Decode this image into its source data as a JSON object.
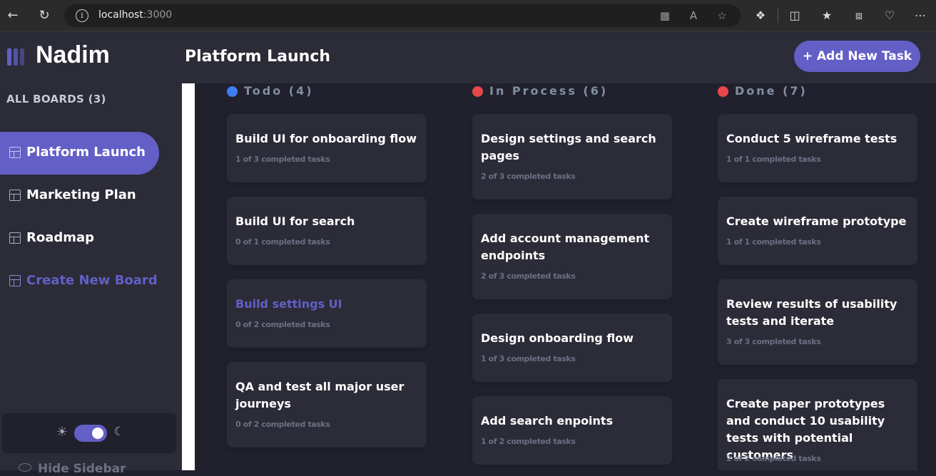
{
  "browser": {
    "url_host": "localhost",
    "url_port": ":3000"
  },
  "sidebar": {
    "brand": "Nadim",
    "all_boards_label": "ALL BOARDS (3)",
    "boards": [
      {
        "label": "Platform Launch"
      },
      {
        "label": "Marketing Plan"
      },
      {
        "label": "Roadmap"
      }
    ],
    "create_board_label": "Create New Board",
    "hide_sidebar_label": "Hide Sidebar",
    "dark_mode": true
  },
  "header": {
    "title": "Platform Launch",
    "add_task_label": "+ Add New Task"
  },
  "colors": {
    "accent": "#635fc7",
    "todo_dot": "#3d7ef0",
    "process_dot": "#e8474c",
    "done_dot": "#e8474c"
  },
  "columns": [
    {
      "title": "Todo (4)",
      "dot_color": "#3d7ef0",
      "tasks": [
        {
          "title": "Build UI for onboarding flow",
          "subtasks": "1 of 3 completed tasks"
        },
        {
          "title": "Build UI for search",
          "subtasks": "0 of 1 completed tasks"
        },
        {
          "title": "Build settings UI",
          "subtasks": "0 of 2 completed tasks"
        },
        {
          "title": "QA and test all major user journeys",
          "subtasks": "0 of 2 completed tasks"
        }
      ]
    },
    {
      "title": "In Process (6)",
      "dot_color": "#e8474c",
      "tasks": [
        {
          "title": "Design settings and search pages",
          "subtasks": "2 of 3 completed tasks"
        },
        {
          "title": "Add account management endpoints",
          "subtasks": "2 of 3 completed tasks"
        },
        {
          "title": "Design onboarding flow",
          "subtasks": "1 of 3 completed tasks"
        },
        {
          "title": "Add search enpoints",
          "subtasks": "1 of 2 completed tasks"
        }
      ]
    },
    {
      "title": "Done (7)",
      "dot_color": "#e8474c",
      "tasks": [
        {
          "title": "Conduct 5 wireframe tests",
          "subtasks": "1 of 1 completed tasks"
        },
        {
          "title": "Create wireframe prototype",
          "subtasks": "1 of 1 completed tasks"
        },
        {
          "title": "Review results of usability tests and iterate",
          "subtasks": "3 of 3 completed tasks"
        },
        {
          "title": "Create paper prototypes and conduct 10 usability tests with potential customers",
          "subtasks": "2 of 2 completed tasks"
        }
      ]
    }
  ]
}
